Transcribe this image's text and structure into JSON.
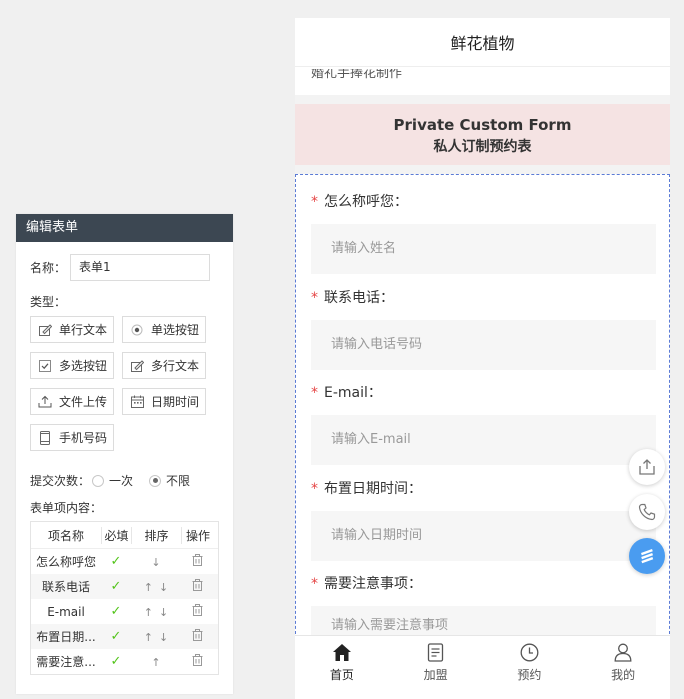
{
  "editor": {
    "title": "编辑表单",
    "name_label": "名称：",
    "name_value": "表单1",
    "type_label": "类型：",
    "types": [
      {
        "label": "单行文本",
        "icon": "edit-icon"
      },
      {
        "label": "单选按钮",
        "icon": "radio-icon"
      },
      {
        "label": "多选按钮",
        "icon": "checkbox-icon"
      },
      {
        "label": "多行文本",
        "icon": "edit-icon"
      },
      {
        "label": "文件上传",
        "icon": "upload-icon"
      },
      {
        "label": "日期时间",
        "icon": "calendar-icon"
      },
      {
        "label": "手机号码",
        "icon": "phone-icon"
      }
    ],
    "submit_label": "提交次数：",
    "submit_options": [
      "一次",
      "不限"
    ],
    "submit_selected": "不限",
    "items_label": "表单项内容：",
    "table_headers": [
      "项名称",
      "必填",
      "排序",
      "操作"
    ],
    "rows": [
      {
        "name": "怎么称呼您"
      },
      {
        "name": "联系电话"
      },
      {
        "name": "E-mail"
      },
      {
        "name": "布置日期..."
      },
      {
        "name": "需要注意..."
      }
    ]
  },
  "preview": {
    "title": "鲜花植物",
    "partial_text": "婚礼手捧花制作",
    "banner_en": "Private Custom Form",
    "banner_cn": "私人订制预约表",
    "fields": [
      {
        "label": "怎么称呼您：",
        "placeholder": "请输入姓名"
      },
      {
        "label": "联系电话：",
        "placeholder": "请输入电话号码"
      },
      {
        "label": "E-mail：",
        "placeholder": "请输入E-mail"
      },
      {
        "label": "布置日期时间：",
        "placeholder": "请输入日期时间"
      },
      {
        "label": "需要注意事项：",
        "placeholder": "请输入需要注意事项"
      }
    ],
    "tabs": [
      {
        "label": "首页",
        "icon": "home-icon"
      },
      {
        "label": "加盟",
        "icon": "document-icon"
      },
      {
        "label": "预约",
        "icon": "clock-icon"
      },
      {
        "label": "我的",
        "icon": "user-icon"
      }
    ]
  },
  "colors": {
    "editor_header": "#3c4752",
    "banner_bg": "#f5e3e3",
    "required_star": "#e54545",
    "check_green": "#52c41a",
    "fab_blue": "#4a9cf0",
    "form_dashed_border": "#5b7bd5"
  }
}
